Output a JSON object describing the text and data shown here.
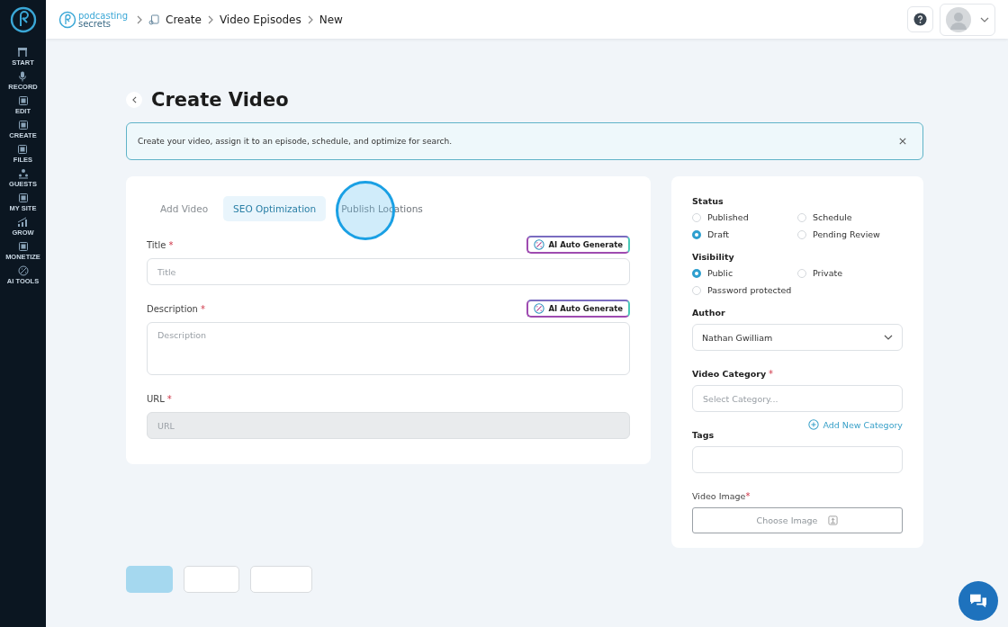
{
  "sidebar": {
    "items": [
      {
        "label": "START"
      },
      {
        "label": "RECORD"
      },
      {
        "label": "EDIT"
      },
      {
        "label": "CREATE"
      },
      {
        "label": "FILES"
      },
      {
        "label": "GUESTS"
      },
      {
        "label": "MY SITE"
      },
      {
        "label": "GROW"
      },
      {
        "label": "MONETIZE"
      },
      {
        "label": "AI TOOLS"
      }
    ]
  },
  "header": {
    "logo": {
      "line_1": "podcasting",
      "line_2": "secrets"
    },
    "breadcrumb": [
      "Create",
      "Video Episodes",
      "New"
    ]
  },
  "page": {
    "title": "Create Video",
    "notice": "Create your video, assign it to an episode, schedule, and optimize for search."
  },
  "tabs": [
    {
      "label": "Add Video",
      "selected": false
    },
    {
      "label": "SEO Optimization",
      "selected": true
    },
    {
      "label": "Publish Locations",
      "selected": false
    }
  ],
  "fields": [
    {
      "label": "Title",
      "required_mark": "*",
      "placeholder": "Title",
      "kind": "input",
      "ai_button": "AI Auto Generate"
    },
    {
      "label": "Description",
      "required_mark": "*",
      "placeholder": "Description",
      "kind": "textarea",
      "ai_button": "AI Auto Generate"
    },
    {
      "label": "URL",
      "required_mark": "*",
      "placeholder": "URL",
      "kind": "input",
      "disabled": true
    }
  ],
  "status": {
    "label": "Status",
    "options": [
      {
        "label": "Published",
        "selected": false
      },
      {
        "label": "Schedule",
        "selected": false
      },
      {
        "label": "Draft",
        "selected": true
      },
      {
        "label": "Pending Review",
        "selected": false
      }
    ]
  },
  "visibility": {
    "label": "Visibility",
    "options": [
      {
        "label": "Public",
        "selected": true
      },
      {
        "label": "Private",
        "selected": false
      },
      {
        "label": "Password protected",
        "selected": false
      }
    ]
  },
  "author": {
    "label": "Author",
    "value": "Nathan Gwilliam"
  },
  "video_category": {
    "label": "Video Category",
    "required_mark": "*",
    "placeholder": "Select Category...",
    "add_link": "Add New Category"
  },
  "tags": {
    "label": "Tags"
  },
  "video_image": {
    "label": "Video Image",
    "required_mark": "*",
    "button": "Choose Image"
  },
  "footer_buttons": [
    {
      "kind": "primary"
    },
    {
      "kind": "secondary"
    },
    {
      "kind": "secondary"
    }
  ]
}
